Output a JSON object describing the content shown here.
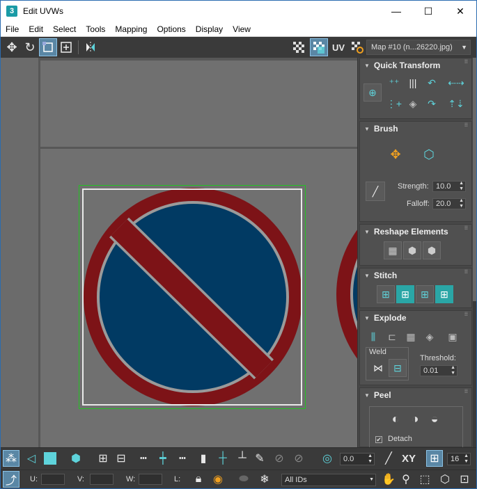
{
  "window": {
    "title": "Edit UVWs",
    "app_icon": "3",
    "controls": {
      "minimize": "—",
      "maximize": "☐",
      "close": "✕"
    }
  },
  "menu": [
    "File",
    "Edit",
    "Select",
    "Tools",
    "Mapping",
    "Options",
    "Display",
    "View"
  ],
  "toolbar": {
    "uv_label": "UV",
    "map_selector": "Map #10 (n...26220.jpg)"
  },
  "panel": {
    "quick_transform": {
      "title": "Quick Transform"
    },
    "brush": {
      "title": "Brush",
      "strength_label": "Strength:",
      "strength_value": "10.0",
      "falloff_label": "Falloff:",
      "falloff_value": "20.0"
    },
    "reshape": {
      "title": "Reshape Elements"
    },
    "stitch": {
      "title": "Stitch"
    },
    "explode": {
      "title": "Explode",
      "weld_label": "Weld",
      "threshold_label": "Threshold:",
      "threshold_value": "0.01"
    },
    "peel": {
      "title": "Peel",
      "detach_label": "Detach",
      "detach_checked": true
    }
  },
  "bottom_bar": {
    "angle_value": "0.0",
    "xy_label": "XY",
    "grid_value": "16",
    "u_label": "U:",
    "v_label": "V:",
    "w_label": "W:",
    "l_label": "L:",
    "ids_select": "All IDs"
  },
  "colors": {
    "sign_red": "#7d1317",
    "sign_blue": "#013a63",
    "sign_gray_ring": "#9a9a9a",
    "viewport_bg": "#707070",
    "tile_border": "#22c322",
    "accent": "#5ed3db"
  }
}
